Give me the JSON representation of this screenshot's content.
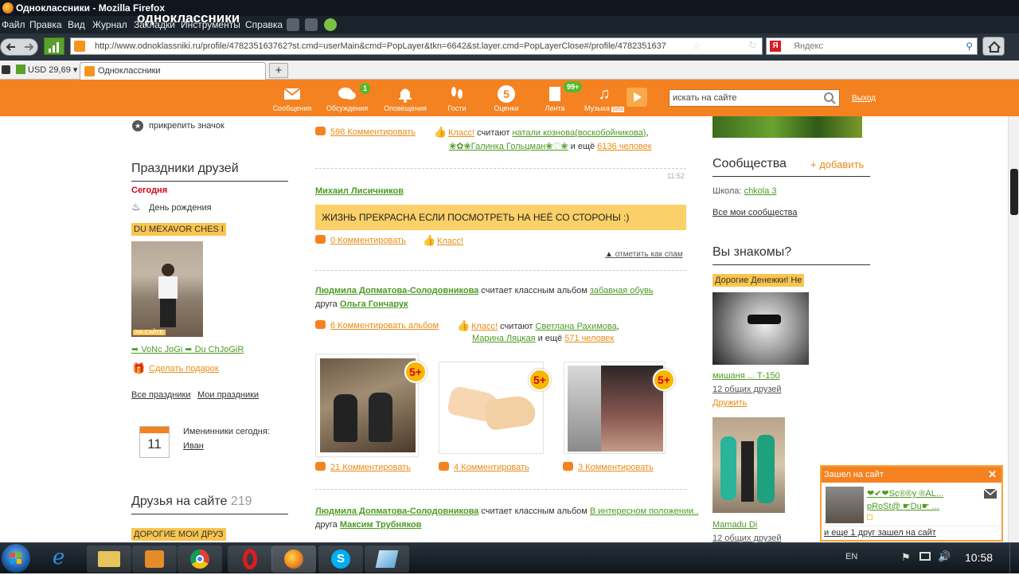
{
  "browser": {
    "window_title": "Одноклассники - Mozilla Firefox",
    "menu": [
      "Файл",
      "Правка",
      "Вид",
      "Журнал",
      "Закладки",
      "Инструменты",
      "Справка"
    ],
    "url": "http://www.odnoklassniki.ru/profile/478235163762?st.cmd=userMain&cmd=PopLayer&tkn=6642&st.layer.cmd=PopLayerClose#/profile/4782351637",
    "search_engine": "Яндекс",
    "currency": "USD 29,69",
    "tab_title": "Одноклассники",
    "new_tab": "+"
  },
  "header": {
    "logo": "одноклассники",
    "nav": [
      {
        "label": "Сообщения",
        "icon": "envelope-icon"
      },
      {
        "label": "Обсуждения",
        "icon": "chat-icon",
        "badge": "1"
      },
      {
        "label": "Оповещения",
        "icon": "bell-icon"
      },
      {
        "label": "Гости",
        "icon": "footprints-icon"
      },
      {
        "label": "Оценки",
        "icon": "rating-icon",
        "value": "5"
      },
      {
        "label": "Лента",
        "icon": "feed-icon",
        "badge": "99+"
      },
      {
        "label": "Музыка",
        "icon": "music-note-icon",
        "sublabel": "beta"
      }
    ],
    "search_placeholder": "искать на сайте",
    "logout": "Выход"
  },
  "left": {
    "pin_badge": "прикрепить значок",
    "holidays_title": "Праздники друзей",
    "today": "Сегодня",
    "birthday": "День рождения",
    "friend_tag": "DU MEXAVOR CHES I",
    "photo_caption": "НА САЙТЕ",
    "friend_name": "➥ VoNc JoGi ➥ Du ChJoGiR",
    "gift": "Сделать подарок",
    "all_holidays": "Все праздники",
    "my_holidays": "Мои праздники",
    "calendar_day": "11",
    "namedays_label": "Именинники сегодня:",
    "nameday_name": "Иван",
    "friends_online_title": "Друзья на сайте",
    "friends_online_count": "219",
    "friend2_tag": "ДОРОГИЕ МОИ ДРУЗ"
  },
  "feed": {
    "top_comments": "598 Комментировать",
    "top_klass": "Класс!",
    "top_text1": "считают",
    "top_user1": "натали кознова(воскобойникова)",
    "top_user2": "❀✿❀Галинка Гольцман❀♡❀",
    "top_more": "и ещё",
    "top_count": "6136 человек",
    "post1_time": "11:52",
    "post1_author": "Михаил Лисичников",
    "post1_text": "ЖИЗНЬ ПРЕКРАСНА ЕСЛИ ПОСМОТРЕТЬ НА НЕЁ СО СТОРОНЫ :)",
    "post1_comments": "0 Комментировать",
    "post1_klass": "Класс!",
    "post1_spam": "отметить как спам",
    "post2_author": "Людмила Допматова-Солодовникова",
    "post2_text": "считает классным альбом",
    "post2_album": "забавная обувь",
    "post2_friend_label": "друга",
    "post2_friend": "Ольга Гончарук",
    "post2_comments": "6 Комментировать альбом",
    "post2_klass": "Класс!",
    "post2_think": "считают",
    "post2_user1": "Светлана Рахимова",
    "post2_user2": "Марина Ляцкая",
    "post2_more": "и ещё",
    "post2_count": "571 человек",
    "photos": [
      {
        "comments": "21 Комментировать",
        "badge": "5+"
      },
      {
        "comments": "4 Комментировать",
        "badge": "5+"
      },
      {
        "comments": "3 Комментировать",
        "badge": "5+"
      }
    ],
    "post3_author": "Людмила Допматова-Солодовникова",
    "post3_text": "считает классным альбом",
    "post3_album": "В интересном положении..",
    "post3_friend_label": "друга",
    "post3_friend": "Максим Трубняков"
  },
  "right": {
    "communities_title": "Сообщества",
    "communities_add": "+ добавить",
    "school_label": "Школа:",
    "school_value": "chkola 3",
    "all_communities": "Все мои сообщества",
    "know_title": "Вы знакомы?",
    "person1_tag": "Дорогие Денежки! Не",
    "person1_name": "мишаня ... Т-150",
    "person1_common": "12 общих друзей",
    "person1_action": "Дружить",
    "person2_name": "Mamadu Di",
    "person2_common": "12 общих друзей"
  },
  "popup": {
    "title": "Зашел на сайт",
    "close": "✕",
    "name_line1": "❤✔❤Sc®®y ®AL...",
    "name_line2": "pRoSt@ ☛Du☛ ...",
    "more": "и еще 1 друг зашел на сайт"
  },
  "taskbar": {
    "lang": "EN",
    "clock": "10:58"
  },
  "colors": {
    "ok_orange": "#f58220",
    "link_green": "#4c9b22",
    "link_orange": "#ea8b16",
    "highlight_yellow": "#fcd068"
  }
}
